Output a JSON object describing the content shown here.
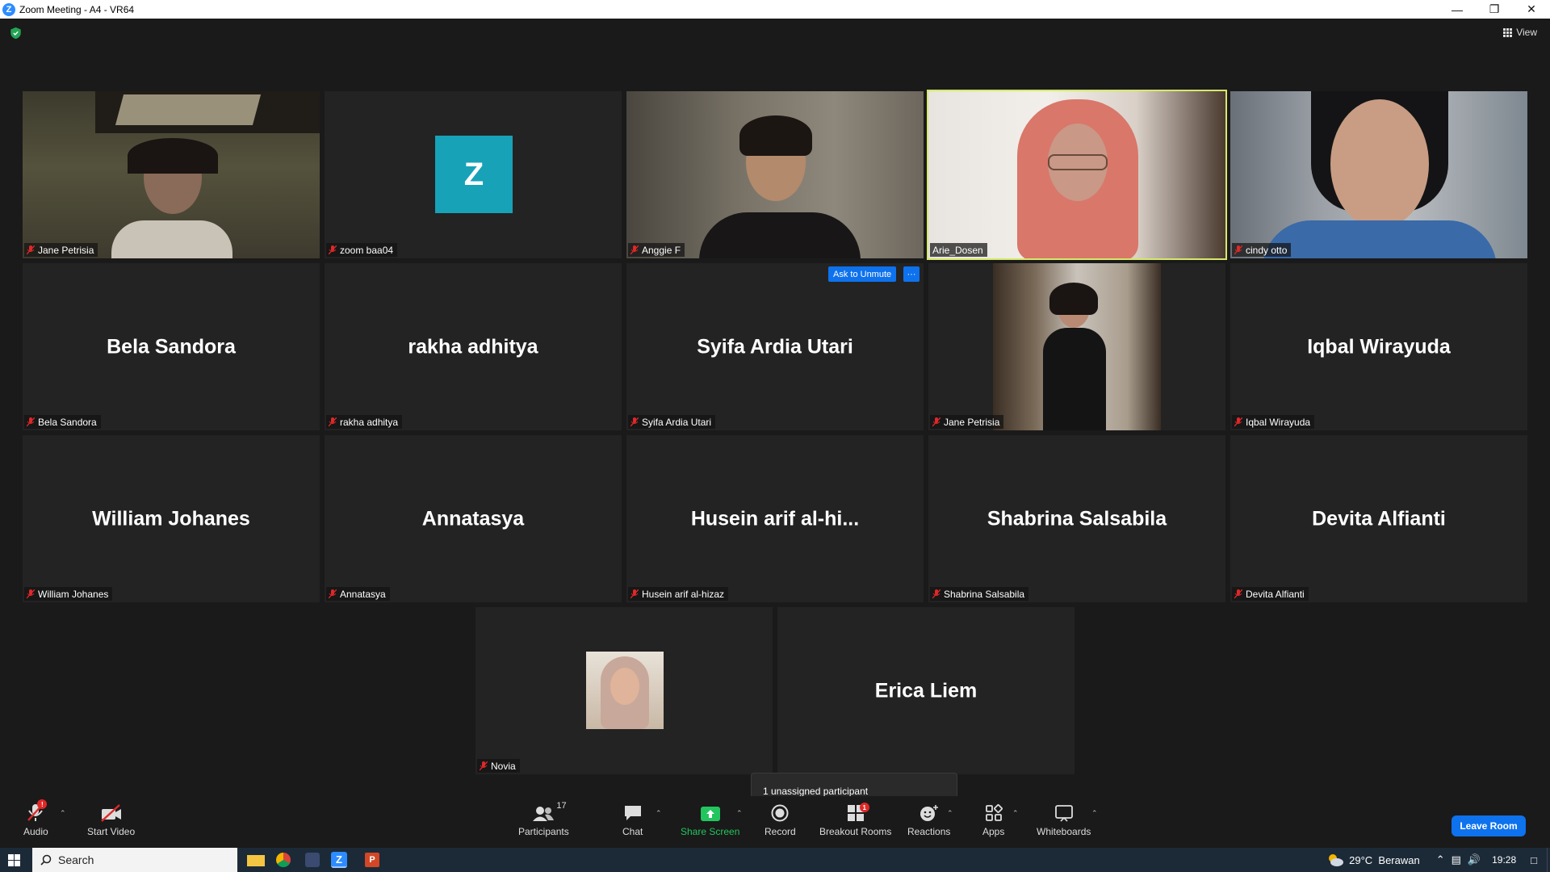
{
  "window": {
    "title": "Zoom Meeting - A4 - VR64"
  },
  "header": {
    "view_label": "View"
  },
  "tiles": [
    {
      "name": "Jane Petrisia"
    },
    {
      "name": "zoom baa04",
      "avatar_letter": "Z"
    },
    {
      "name": "Anggie F"
    },
    {
      "name": "Arie_Dosen"
    },
    {
      "name": "cindy otto"
    },
    {
      "name": "Bela Sandora",
      "display": "Bela Sandora"
    },
    {
      "name": "rakha adhitya",
      "display": "rakha adhitya"
    },
    {
      "name": "Syifa Ardia Utari",
      "display": "Syifa Ardia Utari"
    },
    {
      "name": "Jane Petrisia"
    },
    {
      "name": "Iqbal Wirayuda",
      "display": "Iqbal Wirayuda"
    },
    {
      "name": "William Johanes",
      "display": "William Johanes"
    },
    {
      "name": "Annatasya",
      "display": "Annatasya"
    },
    {
      "name": "Husein arif al-hizaz",
      "display": "Husein arif al-hi..."
    },
    {
      "name": "Shabrina Salsabila",
      "display": "Shabrina Salsabila"
    },
    {
      "name": "Devita Alfianti",
      "display": "Devita Alfianti"
    },
    {
      "name": "Novia"
    },
    {
      "name": "",
      "display": "Erica Liem"
    }
  ],
  "hover": {
    "ask_to_unmute": "Ask to Unmute",
    "more": "···"
  },
  "tooltip": {
    "text": "1 unassigned participant"
  },
  "toolbar": {
    "audio": "Audio",
    "start_video": "Start Video",
    "participants": "Participants",
    "participants_count": "17",
    "chat": "Chat",
    "share_screen": "Share Screen",
    "record": "Record",
    "breakout_rooms": "Breakout Rooms",
    "breakout_badge": "1",
    "reactions": "Reactions",
    "apps": "Apps",
    "whiteboards": "Whiteboards",
    "leave": "Leave Room"
  },
  "taskbar": {
    "search_label": "Search",
    "weather": "29°C  Berawan",
    "time": "19:28"
  },
  "colors": {
    "accent": "#0e72ed",
    "active_speaker": "#d6e86a",
    "share_green": "#22c55e",
    "mute_red": "#e02828"
  }
}
